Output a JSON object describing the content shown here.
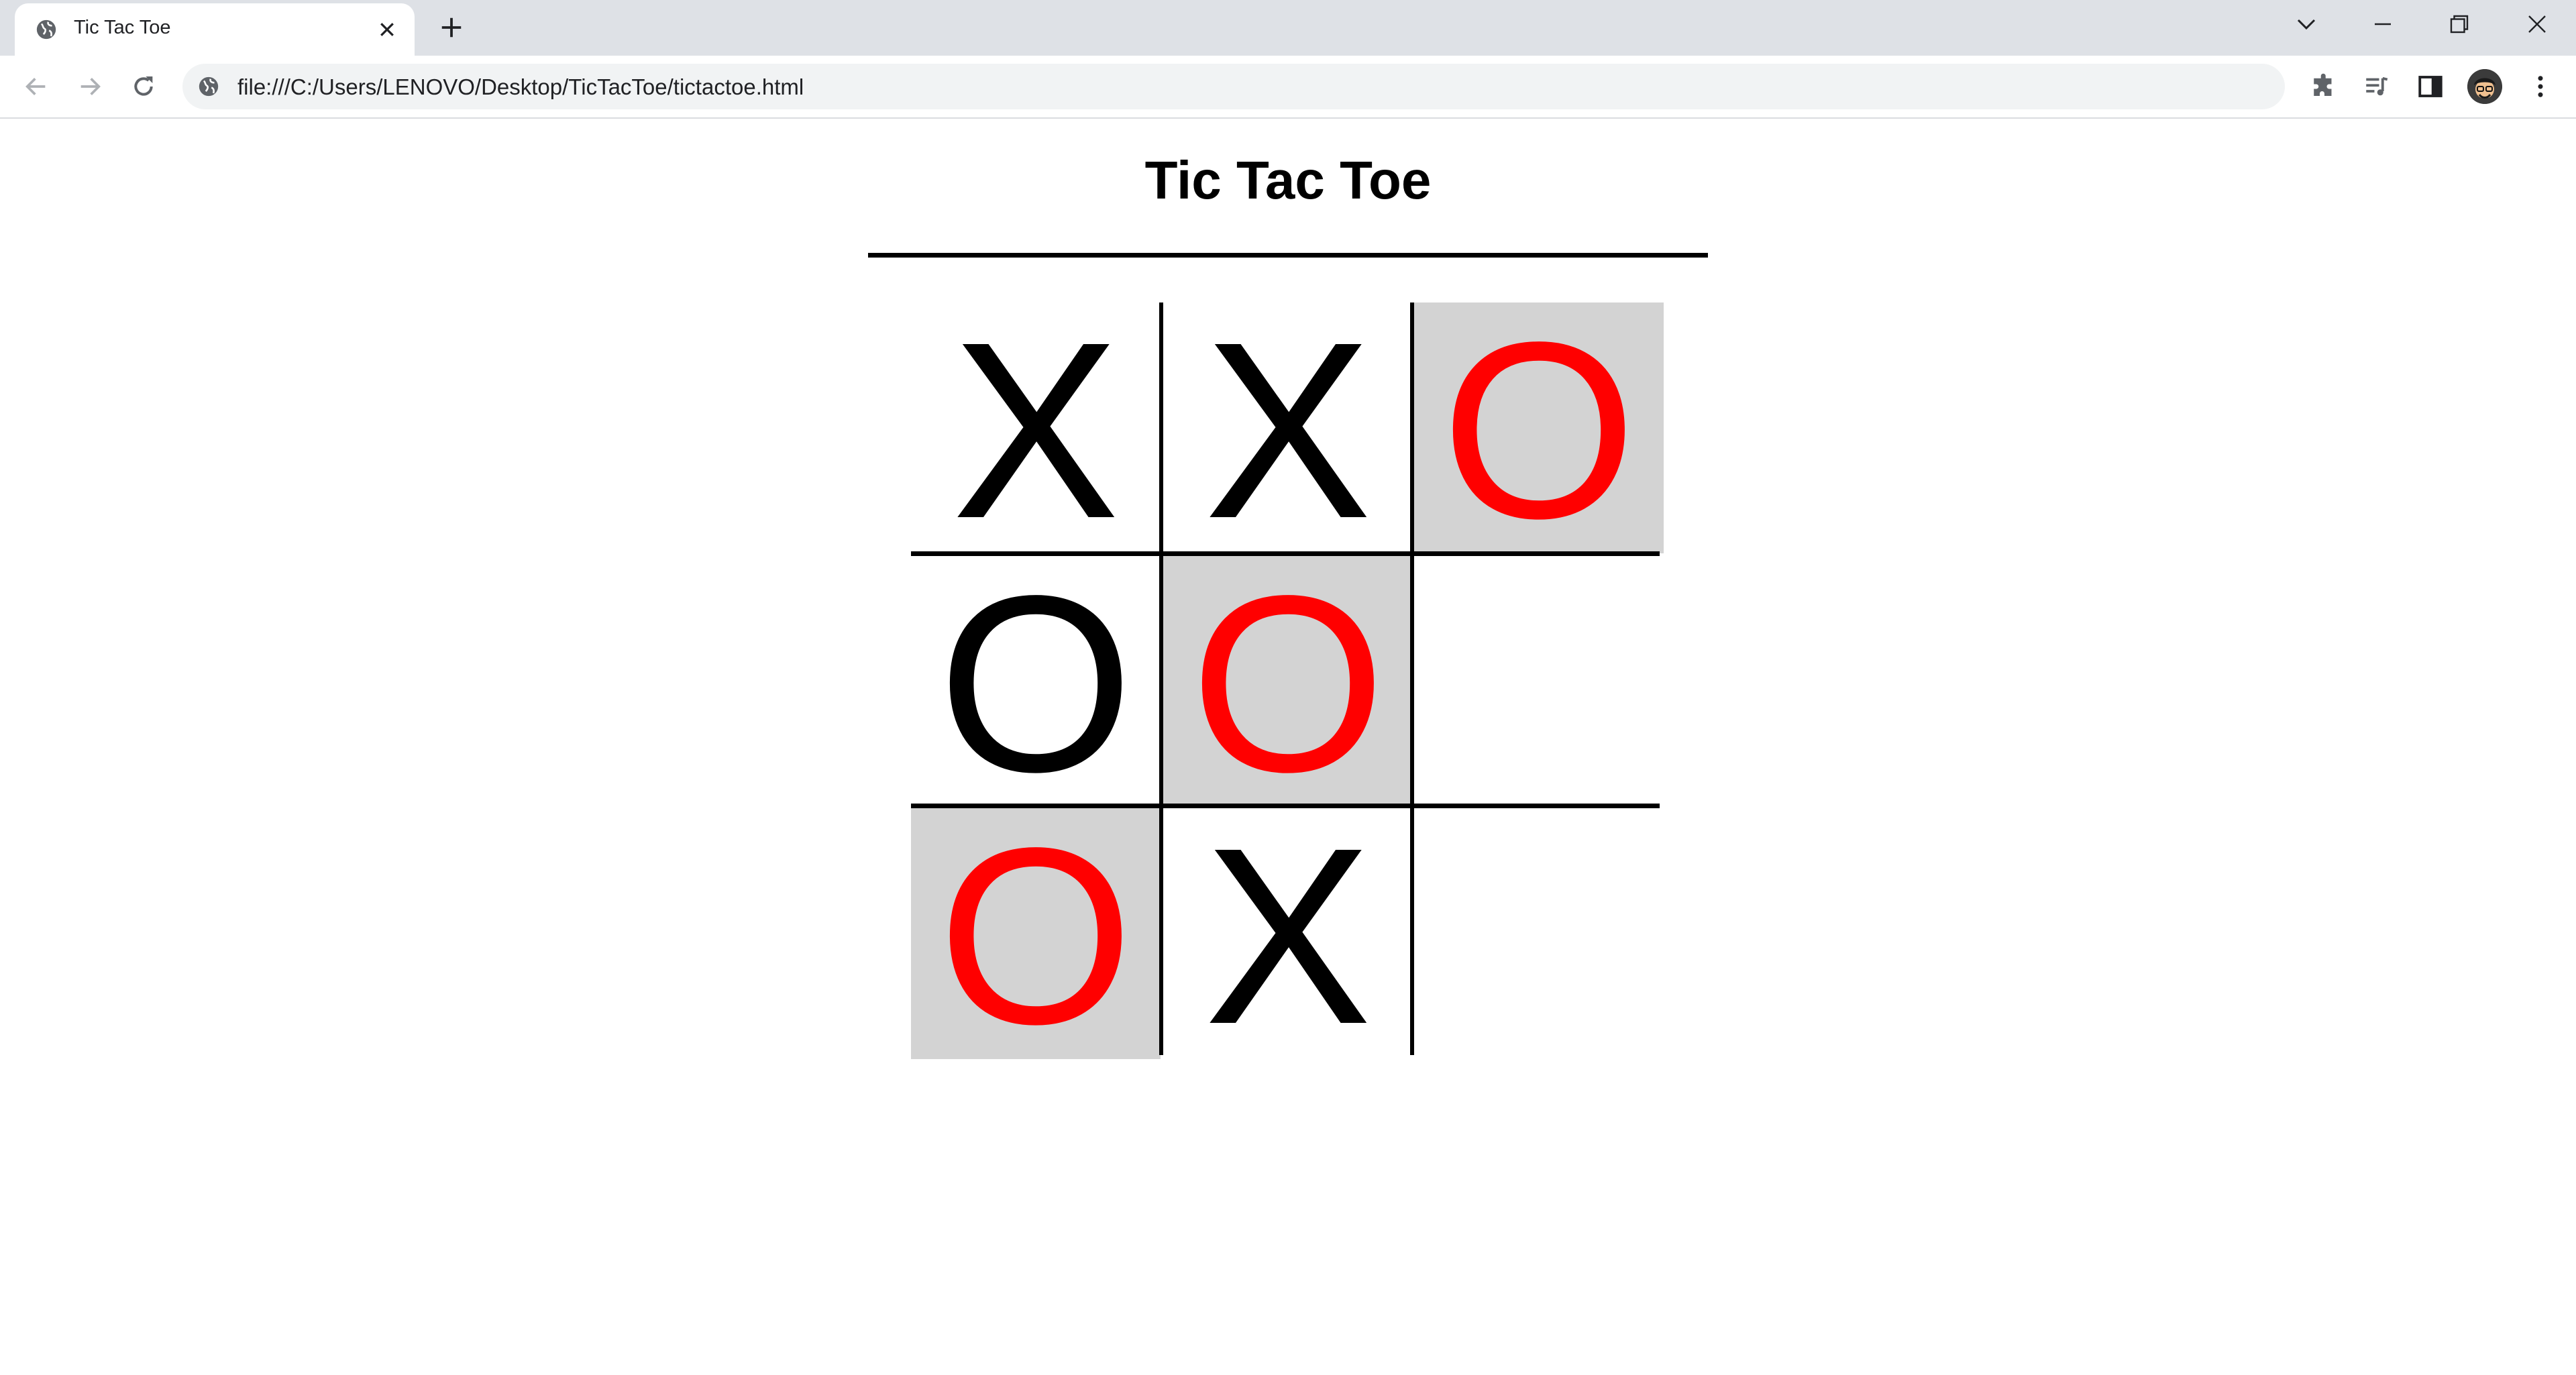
{
  "browser": {
    "tab_title": "Tic Tac Toe",
    "url": "file:///C:/Users/LENOVO/Desktop/TicTacToe/tictactoe.html"
  },
  "page": {
    "title": "Tic Tac Toe"
  },
  "board": {
    "cells": [
      {
        "mark": "X",
        "winning": false
      },
      {
        "mark": "X",
        "winning": false
      },
      {
        "mark": "O",
        "winning": true
      },
      {
        "mark": "O",
        "winning": false
      },
      {
        "mark": "O",
        "winning": true
      },
      {
        "mark": "",
        "winning": false
      },
      {
        "mark": "O",
        "winning": true
      },
      {
        "mark": "X",
        "winning": false
      },
      {
        "mark": "",
        "winning": false
      }
    ]
  },
  "colors": {
    "mark": "#000000",
    "winning_mark": "#ff0000",
    "winning_cell_bg": "#d3d3d3"
  },
  "icons": {
    "tab_favicon": "globe-icon",
    "tab_close": "close-icon",
    "new_tab": "plus-icon",
    "tab_search": "chevron-down-icon",
    "minimize": "minimize-icon",
    "restore": "restore-icon",
    "close_window": "close-icon",
    "back": "back-arrow-icon",
    "forward": "forward-arrow-icon",
    "reload": "reload-icon",
    "site_info": "globe-icon",
    "extensions": "puzzle-icon",
    "media": "media-queue-icon",
    "side_panel": "side-panel-icon",
    "profile": "avatar",
    "menu": "kebab-menu-icon"
  }
}
